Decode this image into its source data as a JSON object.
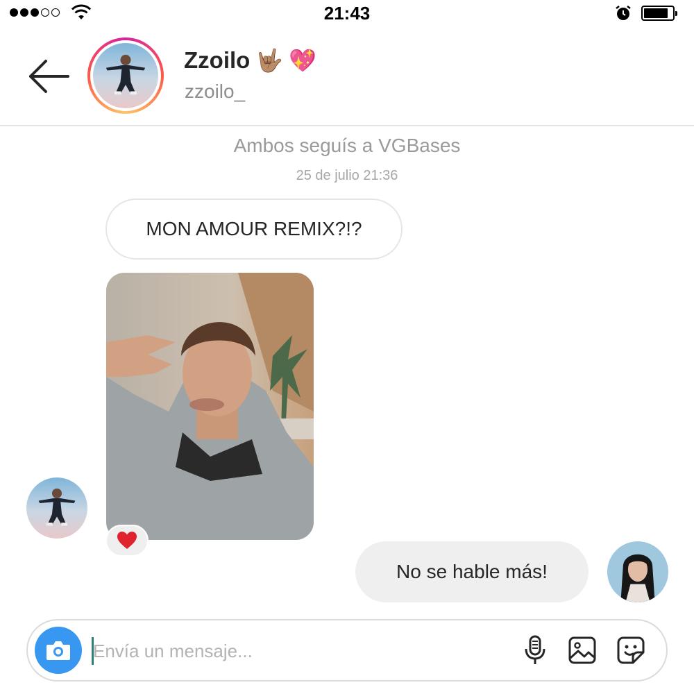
{
  "status_bar": {
    "time": "21:43",
    "signal_bars": 5,
    "signal_filled": 3,
    "battery_level": 0.85,
    "icons": [
      "signal-dots-icon",
      "wifi-icon",
      "alarm-clock-icon",
      "battery-icon"
    ]
  },
  "header": {
    "name": "Zzoilo",
    "name_emojis": [
      "🤟🏽",
      "💖"
    ],
    "username": "zzoilo_",
    "back_icon": "arrow-left-icon",
    "story_ring_colors": [
      "#d6249f",
      "#fd5949",
      "#fdc468"
    ]
  },
  "thread": {
    "context": "Ambos seguís a VGBases",
    "timestamp": "25 de julio 21:36",
    "messages": [
      {
        "direction": "incoming",
        "type": "text",
        "text": "MON AMOUR REMIX?!?"
      },
      {
        "direction": "incoming",
        "type": "photo",
        "reaction": "❤️"
      },
      {
        "direction": "outgoing",
        "type": "text",
        "text": "No se hable más!"
      }
    ]
  },
  "composer": {
    "placeholder": "Envía un mensaje...",
    "value": "",
    "buttons": [
      "camera-icon",
      "microphone-icon",
      "gallery-icon",
      "sticker-icon"
    ],
    "camera_color": "#3897f0"
  },
  "colors": {
    "accent": "#3897f0",
    "heart": "#e0242f",
    "bubble_out": "#efefef",
    "divider": "#e3e3e3"
  }
}
